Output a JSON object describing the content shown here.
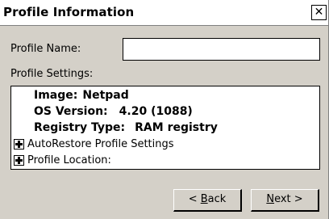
{
  "window": {
    "title": "Profile Information",
    "close_glyph": "✕"
  },
  "form": {
    "profile_name_label": "Profile Name:",
    "profile_name_value": "",
    "profile_settings_label": "Profile Settings:"
  },
  "settings": {
    "image_key": "Image:",
    "image_value": "Netpad",
    "os_key": "OS Version:",
    "os_value": "4.20 (1088)",
    "registry_key": "Registry Type:",
    "registry_value": "RAM registry",
    "tree_items": [
      {
        "label": "AutoRestore Profile Settings",
        "icon": "plus-expand-icon"
      },
      {
        "label": "Profile Location:",
        "icon": "plus-expand-icon"
      }
    ]
  },
  "buttons": {
    "back_prefix": "< ",
    "back_mnemonic": "B",
    "back_rest": "ack",
    "next_mnemonic": "N",
    "next_rest": "ext >"
  }
}
